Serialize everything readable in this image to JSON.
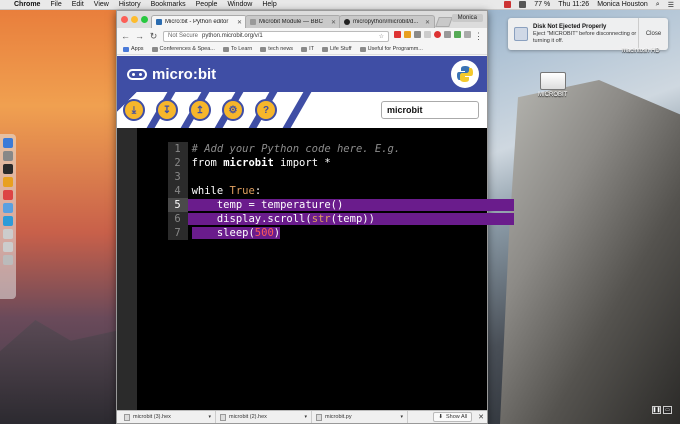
{
  "menubar": {
    "app": "Chrome",
    "items": [
      "File",
      "Edit",
      "View",
      "History",
      "Bookmarks",
      "People",
      "Window",
      "Help"
    ],
    "battery": "77 %",
    "clock": "Thu 11:26",
    "user": "Monica Houston"
  },
  "notification": {
    "title": "Disk Not Ejected Properly",
    "body": "Eject \"MICROBIT\" before disconnecting or turning it off.",
    "close_label": "Close"
  },
  "desktop": {
    "drives": [
      {
        "label": "Macintosh HD"
      },
      {
        "label": "MICROBIT"
      }
    ]
  },
  "browser": {
    "tabs": [
      {
        "label": "Micro:bit - Python editor",
        "active": true
      },
      {
        "label": "Microbit Module — BBC",
        "active": false
      },
      {
        "label": "micropython/microbit/d...",
        "active": false
      }
    ],
    "profile": "Monica",
    "address": {
      "security": "Not Secure",
      "url": "python.microbit.org/v/1"
    },
    "bookmarks": [
      "Apps",
      "Conferences & Spea...",
      "To Learn",
      "tech news",
      "IT",
      "Life Stuff",
      "Useful for Programm..."
    ]
  },
  "editor_page": {
    "logo_text": "micro:bit",
    "toolbar_icons": [
      "download-icon",
      "save-icon",
      "load-icon",
      "snippets-icon",
      "help-icon"
    ],
    "script_name": "microbit",
    "code_lines": [
      {
        "n": "1",
        "text": "# Add your Python code here. E.g."
      },
      {
        "n": "2",
        "text": "from microbit import *"
      },
      {
        "n": "3",
        "text": ""
      },
      {
        "n": "4",
        "text": "while True:"
      },
      {
        "n": "5",
        "text": "    temp = temperature()"
      },
      {
        "n": "6",
        "text": "    display.scroll(str(temp))"
      },
      {
        "n": "7",
        "text": "    sleep(500)"
      }
    ],
    "active_line": "5"
  },
  "downloads": {
    "items": [
      "microbit (3).hex",
      "microbit (2).hex",
      "microbit.py"
    ],
    "show_all": "Show All"
  }
}
